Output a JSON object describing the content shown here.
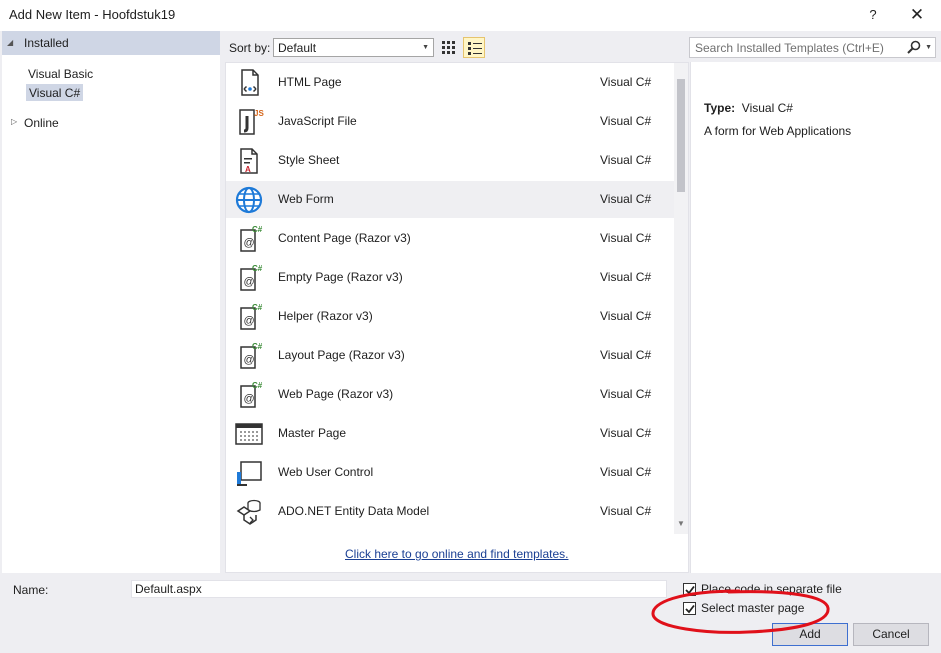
{
  "window": {
    "title": "Add New Item - Hoofdstuk19",
    "help_glyph": "?",
    "close_glyph": "✕"
  },
  "sidebar": {
    "installed": "Installed",
    "items": [
      "Visual Basic",
      "Visual C#"
    ],
    "online": "Online"
  },
  "toolbar": {
    "sort_label": "Sort by:",
    "sort_value": "Default",
    "search_placeholder": "Search Installed Templates (Ctrl+E)"
  },
  "templates": [
    {
      "name": "HTML Page",
      "lang": "Visual C#",
      "icon": "html-page-icon"
    },
    {
      "name": "JavaScript File",
      "lang": "Visual C#",
      "icon": "javascript-file-icon"
    },
    {
      "name": "Style Sheet",
      "lang": "Visual C#",
      "icon": "style-sheet-icon"
    },
    {
      "name": "Web Form",
      "lang": "Visual C#",
      "icon": "web-form-globe-icon",
      "selected": true
    },
    {
      "name": "Content Page (Razor v3)",
      "lang": "Visual C#",
      "icon": "razor-page-icon"
    },
    {
      "name": "Empty Page (Razor v3)",
      "lang": "Visual C#",
      "icon": "razor-page-icon"
    },
    {
      "name": "Helper (Razor v3)",
      "lang": "Visual C#",
      "icon": "razor-page-icon"
    },
    {
      "name": "Layout Page (Razor v3)",
      "lang": "Visual C#",
      "icon": "razor-page-icon"
    },
    {
      "name": "Web Page (Razor v3)",
      "lang": "Visual C#",
      "icon": "razor-page-icon"
    },
    {
      "name": "Master Page",
      "lang": "Visual C#",
      "icon": "master-page-icon"
    },
    {
      "name": "Web User Control",
      "lang": "Visual C#",
      "icon": "web-user-control-icon"
    },
    {
      "name": "ADO.NET Entity Data Model",
      "lang": "Visual C#",
      "icon": "entity-data-model-icon"
    }
  ],
  "online_link": "Click here to go online and find templates.",
  "description": {
    "type_label": "Type:",
    "type_value": "Visual C#",
    "text": "A form for Web Applications"
  },
  "bottom": {
    "name_label": "Name:",
    "name_value": "Default.aspx",
    "place_code_label": "Place code in separate file",
    "place_code_checked": true,
    "master_page_label": "Select master page",
    "master_page_checked": true,
    "add_label": "Add",
    "cancel_label": "Cancel"
  },
  "colors": {
    "selection": "#cfd6e5",
    "annotation": "#e0101a",
    "link": "#1a3f93"
  }
}
